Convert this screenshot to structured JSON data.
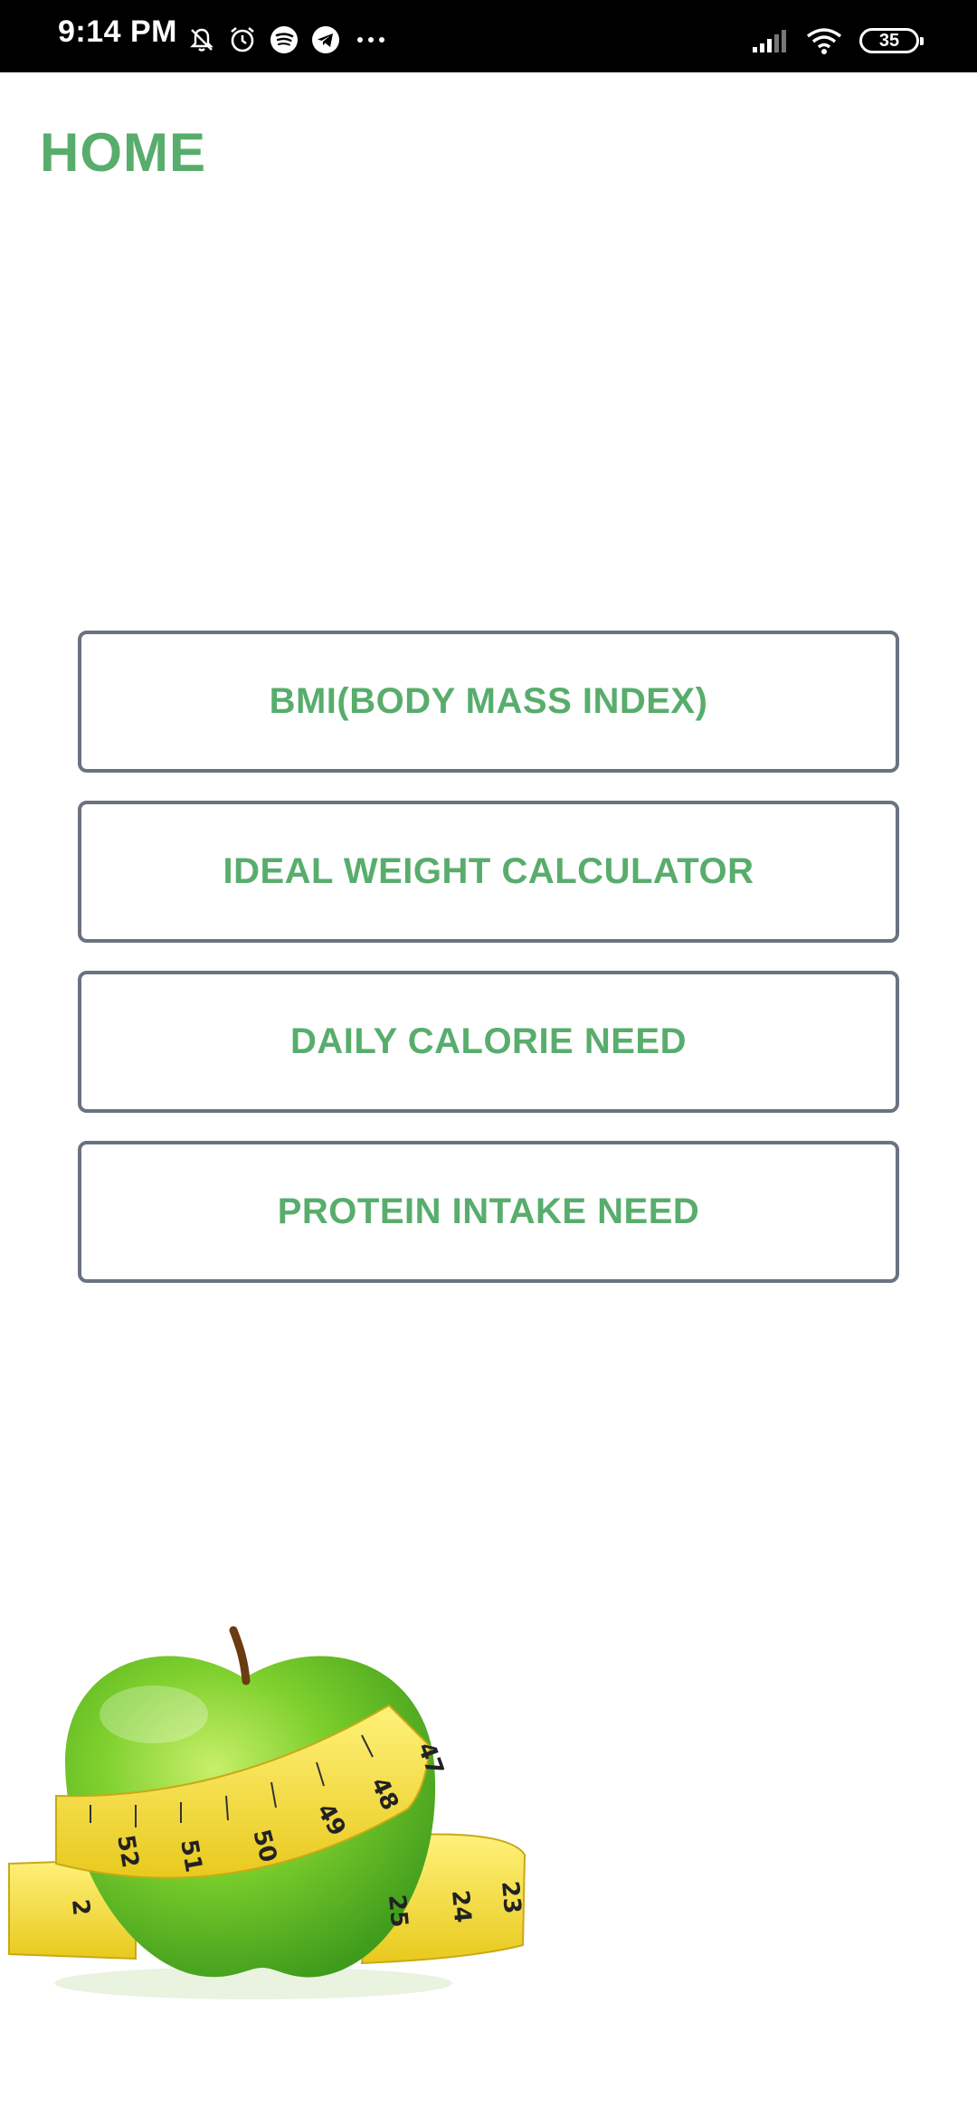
{
  "status_bar": {
    "time": "9:14 PM",
    "battery": "35",
    "icons": [
      "mute-icon",
      "alarm-icon",
      "spotify-icon",
      "telegram-icon",
      "more-dots-icon",
      "signal-icon",
      "wifi-icon",
      "battery-icon"
    ]
  },
  "header": {
    "title": "HOME"
  },
  "menu": {
    "items": [
      {
        "label": "BMI(BODY MASS INDEX)"
      },
      {
        "label": "IDEAL WEIGHT CALCULATOR"
      },
      {
        "label": "DAILY CALORIE NEED"
      },
      {
        "label": "PROTEIN INTAKE NEED"
      }
    ]
  },
  "illustration": {
    "tape_numbers": [
      "47",
      "48",
      "49",
      "50",
      "51",
      "52",
      "2",
      "25",
      "24",
      "23"
    ],
    "icon": "apple-with-measuring-tape"
  },
  "colors": {
    "accent": "#58ad6c",
    "button_border": "#6b7281",
    "status_bar_bg": "#000000"
  }
}
